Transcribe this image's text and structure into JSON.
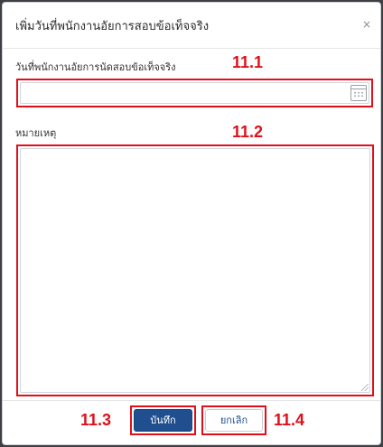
{
  "dialog": {
    "title": "เพิ่มวันที่พนักงานอัยการสอบข้อเท็จจริง",
    "close_glyph": "×"
  },
  "form": {
    "date_label": "วันที่พนักงานอัยการนัดสอบข้อเท็จจริง",
    "date_value": "",
    "note_label": "หมายเหตุ",
    "note_value": ""
  },
  "buttons": {
    "save_label": "บันทึก",
    "cancel_label": "ยกเลิก"
  },
  "annotations": {
    "date_marker": "11.1",
    "note_marker": "11.2",
    "save_marker": "11.3",
    "cancel_marker": "11.4",
    "color": "#e0101a"
  },
  "icons": {
    "calendar": "calendar-icon",
    "close": "close-icon",
    "resize": "resize-grip-icon"
  }
}
